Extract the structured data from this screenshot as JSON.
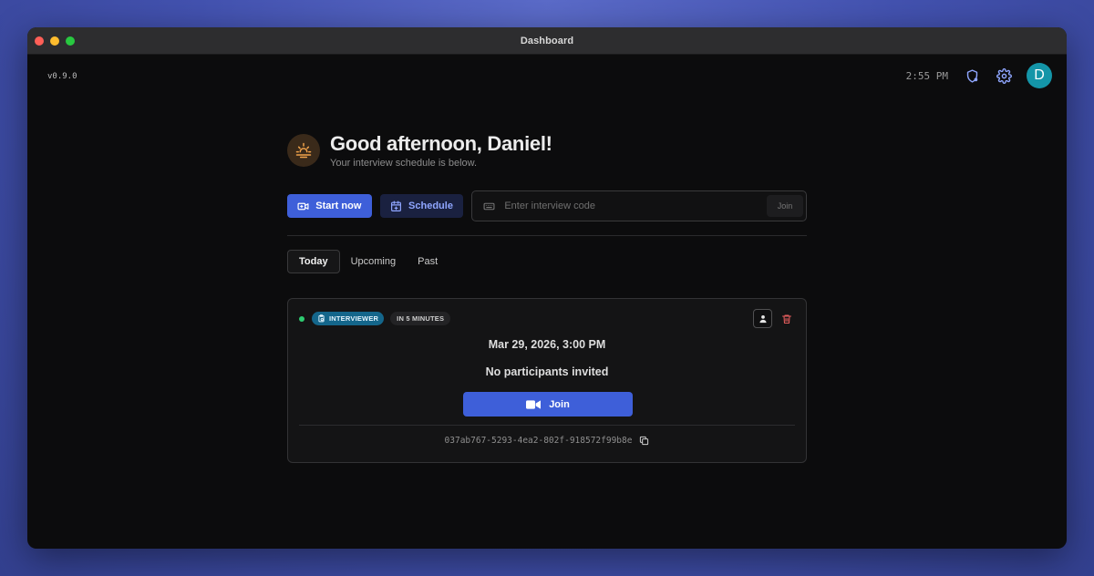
{
  "window": {
    "title": "Dashboard"
  },
  "header": {
    "version": "v0.9.0",
    "time": "2:55 PM",
    "avatar_initial": "D"
  },
  "greeting": {
    "title": "Good afternoon, Daniel!",
    "subtitle": "Your interview schedule is below."
  },
  "actions": {
    "start_label": "Start now",
    "schedule_label": "Schedule",
    "code_placeholder": "Enter interview code",
    "join_label": "Join"
  },
  "tabs": [
    {
      "label": "Today",
      "active": true
    },
    {
      "label": "Upcoming",
      "active": false
    },
    {
      "label": "Past",
      "active": false
    }
  ],
  "interview": {
    "role_badge": "INTERVIEWER",
    "time_badge": "IN 5 MINUTES",
    "datetime": "Mar 29, 2026, 3:00 PM",
    "participants": "No participants invited",
    "join_label": "Join",
    "id": "037ab767-5293-4ea2-802f-918572f99b8e",
    "status_color": "#2ecc71"
  },
  "colors": {
    "accent": "#3e5fd9",
    "avatar": "#1495a8",
    "role_badge": "#14668b"
  }
}
